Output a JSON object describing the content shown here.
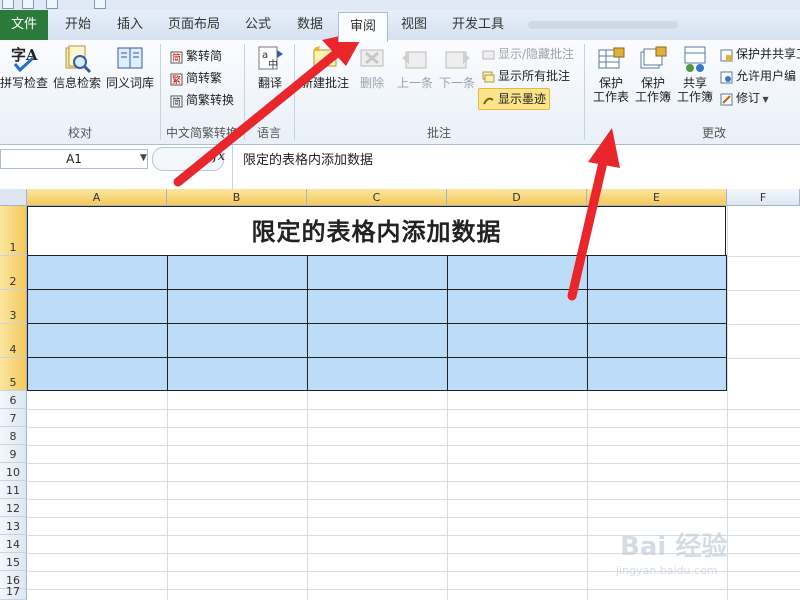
{
  "ribbon_tabs": [
    "文件",
    "开始",
    "插入",
    "页面布局",
    "公式",
    "数据",
    "审阅",
    "视图",
    "开发工具"
  ],
  "active_tab": "审阅",
  "groups": {
    "proofing": {
      "label": "校对",
      "buttons": [
        "拼写检查",
        "信息检索",
        "同义词库"
      ]
    },
    "chinese": {
      "label": "中文简繁转换",
      "buttons": [
        "繁转简",
        "简转繁",
        "简繁转换"
      ]
    },
    "language": {
      "label": "语言",
      "translate": "翻译"
    },
    "comments": {
      "label": "批注",
      "new_comment": "新建批注",
      "delete": "删除",
      "prev": "上一条",
      "next": "下一条",
      "show_hide": "显示/隐藏批注",
      "show_all": "显示所有批注",
      "show_ink": "显示墨迹"
    },
    "changes": {
      "label": "更改",
      "protect_sheet_l1": "保护",
      "protect_sheet_l2": "工作表",
      "protect_wb_l1": "保护",
      "protect_wb_l2": "工作簿",
      "share_wb_l1": "共享",
      "share_wb_l2": "工作簿",
      "protect_share": "保护并共享工",
      "allow_edit": "允许用户编",
      "track": "修订"
    }
  },
  "formula_bar": {
    "name_box": "A1",
    "fx": "fx",
    "content": "限定的表格内添加数据"
  },
  "columns": [
    "A",
    "B",
    "C",
    "D",
    "E",
    "F"
  ],
  "rows": [
    "1",
    "2",
    "3",
    "4",
    "5",
    "6",
    "7",
    "8",
    "9",
    "10",
    "11",
    "12",
    "13",
    "14",
    "15",
    "16",
    "17"
  ],
  "title_cell": "限定的表格内添加数据",
  "watermark": {
    "line1": "Bai 经验",
    "line2": "jingyan.baidu.com"
  },
  "colors": {
    "file_tab": "#2a7a3b",
    "data_fill": "#bcdcf8",
    "arrow": "#e8262b"
  }
}
